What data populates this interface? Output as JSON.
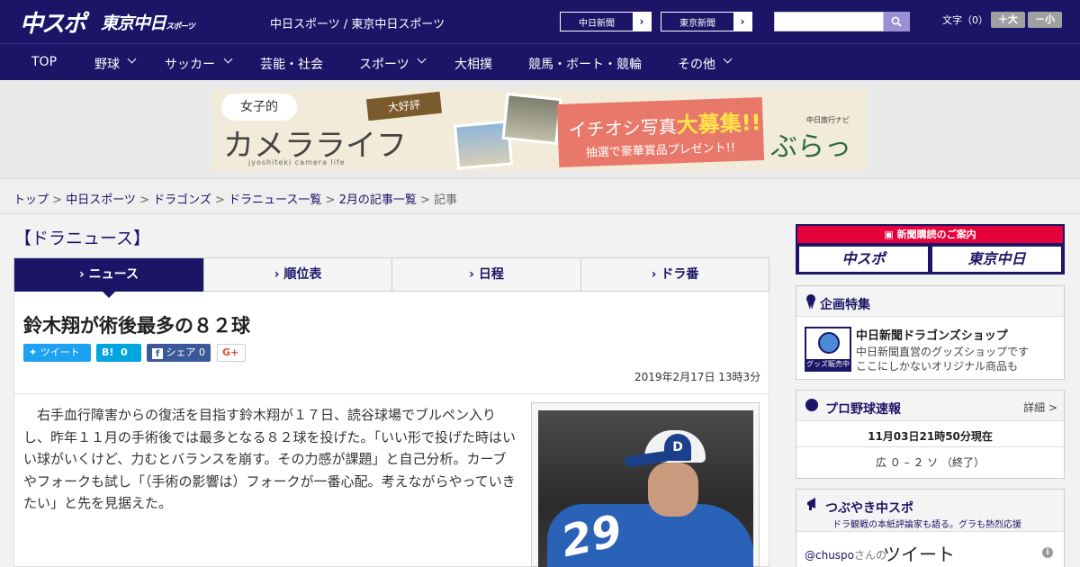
{
  "header": {
    "logo_main": "中スポ",
    "logo_tokyo": "東京中日",
    "logo_tokyo_small": "スポーツ",
    "site_name": "中日スポーツ / 東京中日スポーツ",
    "ext_links": [
      {
        "label": "中日新聞",
        "arrow": "›"
      },
      {
        "label": "東京新聞",
        "arrow": "›"
      }
    ],
    "search": {
      "value": "",
      "placeholder": ""
    },
    "font_size_label": "文字（0）",
    "font_plus": "＋大",
    "font_minus": "－小"
  },
  "nav": {
    "items": [
      {
        "label": "TOP"
      },
      {
        "label": "野球"
      },
      {
        "label": "サッカー"
      },
      {
        "label": "芸能・社会"
      },
      {
        "label": "スポーツ"
      },
      {
        "label": "大相撲"
      },
      {
        "label": "競馬・ボート・競輪"
      },
      {
        "label": "その他"
      }
    ]
  },
  "banner": {
    "bubble": "女子的",
    "title": "カメラライフ",
    "subtitle": "jyoshiteki camera life",
    "tag": "大好評",
    "red_line1_pre": "イチオシ写真",
    "red_line1_big": "大募集!!",
    "red_line2": "抽選で豪華賞品プレゼント!!",
    "right_small": "中日旅行ナビ",
    "right_big": "ぶらっ人"
  },
  "breadcrumb": {
    "items": [
      "トップ",
      "中日スポーツ",
      "ドラゴンズ",
      "ドラニュース一覧",
      "2月の記事一覧"
    ],
    "current": "記事",
    "sep": " > "
  },
  "section_title": "【ドラニュース】",
  "tabs": [
    {
      "label": "ニュース",
      "active": true
    },
    {
      "label": "順位表",
      "active": false
    },
    {
      "label": "日程",
      "active": false
    },
    {
      "label": "ドラ番",
      "active": false
    }
  ],
  "article": {
    "headline": "鈴木翔が術後最多の８２球",
    "share": {
      "tweet": "ツイート",
      "hatena_label": "B!",
      "hatena_count": "0",
      "fb_label": "シェア",
      "fb_count": "0",
      "gplus": "G+"
    },
    "date": "2019年2月17日 13時3分",
    "body": "右手血行障害からの復活を目指す鈴木翔が１７日、読谷球場でブルペン入りし、昨年１１月の手術後では最多となる８２球を投げた。「いい形で投げた時はいい球がいくけど、力むとバランスを崩す。その力感が課題」と自己分析。カーブやフォークも試し「（手術の影響は）フォークが一番心配。考えながらやっていきたい」と先を見据えた。",
    "photo_cap_letter": "D",
    "photo_number": "29"
  },
  "sidebar": {
    "subscribe": {
      "top": "新聞購読のご案内",
      "logo1": "中スポ",
      "logo2": "東京中日"
    },
    "special": {
      "title": "企画特集",
      "shop_tag": "グッズ販売中",
      "shop_title": "中日新聞ドラゴンズショップ",
      "shop_line1": "中日新聞直営のグッズショップです",
      "shop_line2": "ここにしかないオリジナル商品も"
    },
    "baseball": {
      "title": "プロ野球速報",
      "detail": "詳細 >",
      "time": "11月03日21時50分現在",
      "score": "広 ０ – ２ ソ （終了）"
    },
    "tweets": {
      "title": "つぶやき中スポ",
      "sub": "ドラ観戦の本紙評論家も語る。グラも熱烈応援",
      "handle": "@chuspo",
      "handle_suffix": "さんの",
      "word": "ツイート",
      "info": "i"
    }
  },
  "colors": {
    "brand_navy": "#1c1467",
    "accent_red": "#e4003a",
    "twitter_blue": "#1da1f2",
    "hatena_blue": "#00a4de",
    "facebook_blue": "#3b5998"
  }
}
